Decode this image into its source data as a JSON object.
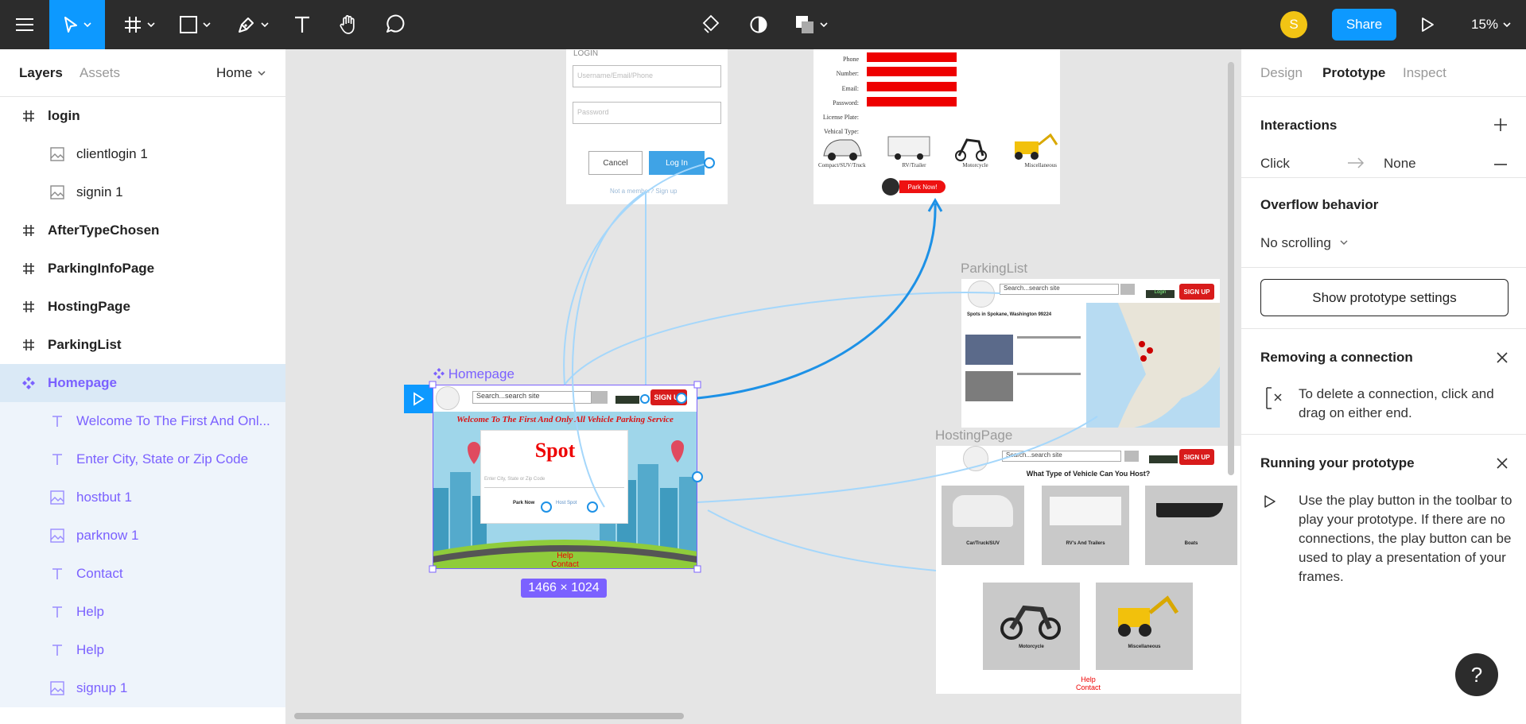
{
  "toolbar": {
    "avatar_initial": "S",
    "share_label": "Share",
    "zoom_label": "15%",
    "accent": "#0d99ff"
  },
  "left_panel": {
    "tabs": {
      "layers": "Layers",
      "assets": "Assets"
    },
    "page_select": "Home",
    "layers": [
      {
        "label": "login",
        "icon": "frame-hash-icon"
      },
      {
        "label": "clientlogin 1",
        "icon": "image-icon"
      },
      {
        "label": "signin 1",
        "icon": "image-icon"
      },
      {
        "label": "AfterTypeChosen",
        "icon": "frame-hash-icon"
      },
      {
        "label": "ParkingInfoPage",
        "icon": "frame-hash-icon"
      },
      {
        "label": "HostingPage",
        "icon": "frame-hash-icon"
      },
      {
        "label": "ParkingList",
        "icon": "frame-hash-icon"
      },
      {
        "label": "Homepage",
        "icon": "component-icon"
      },
      {
        "label": "Welcome To The First And Onl...",
        "icon": "text-icon"
      },
      {
        "label": "Enter City, State or Zip Code",
        "icon": "text-icon"
      },
      {
        "label": "hostbut 1",
        "icon": "image-icon"
      },
      {
        "label": "parknow 1",
        "icon": "image-icon"
      },
      {
        "label": "Contact",
        "icon": "text-icon"
      },
      {
        "label": "Help",
        "icon": "text-icon"
      },
      {
        "label": "Help",
        "icon": "text-icon"
      },
      {
        "label": "signup 1",
        "icon": "image-icon"
      }
    ]
  },
  "canvas": {
    "login_frame": {
      "heading": "LOGIN",
      "username_placeholder": "Username/Email/Phone",
      "password_placeholder": "Password",
      "cancel": "Cancel",
      "login": "Log In",
      "signup_prompt": "Not a member? Sign up"
    },
    "after_type_frame": {
      "fields": [
        "Phone Number:",
        "Email:",
        "Password:",
        "License Plate:",
        "Vehical Type:"
      ],
      "vehicles": [
        "Compact/SUV/Truck",
        "RV/Trailer",
        "Motorcycle",
        "Miscellaneous"
      ],
      "park_now": "Park Now!"
    },
    "parkinglist": {
      "label": "ParkingList",
      "search": "Search...search site",
      "login": "Login",
      "signup": "SIGN UP",
      "heading": "Spots in Spokane, Washington 99224"
    },
    "hostingpage": {
      "label": "HostingPage",
      "search": "Search...search site",
      "signup": "SIGN UP",
      "question": "What Type of Vehicle Can You Host?",
      "cards": [
        "Car/Truck/SUV",
        "RV's And Trailers",
        "Boats",
        "Motorcycle",
        "Miscellaneous"
      ],
      "help": "Help",
      "contact": "Contact"
    },
    "homepage": {
      "label": "Homepage",
      "search": "Search...search site",
      "signup": "SIGN UP",
      "welcome": "Welcome To The First And Only All Vehicle Parking Service",
      "logo": "Spot",
      "city_placeholder": "Enter City, State or Zip Code",
      "park_now": "Park Now",
      "host": "Host Spot",
      "help": "Help",
      "contact": "Contact",
      "size_badge": "1466 × 1024"
    }
  },
  "right_panel": {
    "tabs": {
      "design": "Design",
      "prototype": "Prototype",
      "inspect": "Inspect"
    },
    "interactions": {
      "title": "Interactions",
      "trigger": "Click",
      "destination": "None"
    },
    "overflow": {
      "title": "Overflow behavior",
      "value": "No scrolling"
    },
    "prototype_settings_button": "Show prototype settings",
    "removing": {
      "title": "Removing a connection",
      "text": "To delete a connection, click and drag on either end."
    },
    "running": {
      "title": "Running your prototype",
      "text": "Use the play button in the toolbar to play your prototype. If there are no connections, the play button can be used to play a presentation of your frames."
    }
  },
  "help_button": "?"
}
